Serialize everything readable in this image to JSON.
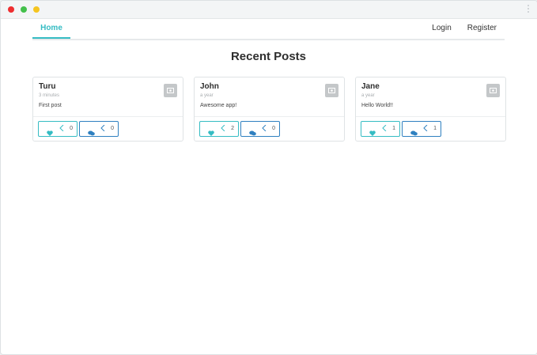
{
  "nav": {
    "home": "Home",
    "login": "Login",
    "register": "Register"
  },
  "page": {
    "title": "Recent Posts"
  },
  "posts": [
    {
      "author": "Turu",
      "time": "3 minutes",
      "text": "First post",
      "likes": "0",
      "comments": "0"
    },
    {
      "author": "John",
      "time": "a year",
      "text": "Awesome app!",
      "likes": "2",
      "comments": "0"
    },
    {
      "author": "Jane",
      "time": "a year",
      "text": "Hello World!!",
      "likes": "1",
      "comments": "1"
    }
  ],
  "colors": {
    "accent": "#35bcc3",
    "comment": "#2f80c0"
  },
  "icons": {
    "like": "heart-icon",
    "comment": "comment-icon",
    "avatar": "image-placeholder-icon"
  }
}
